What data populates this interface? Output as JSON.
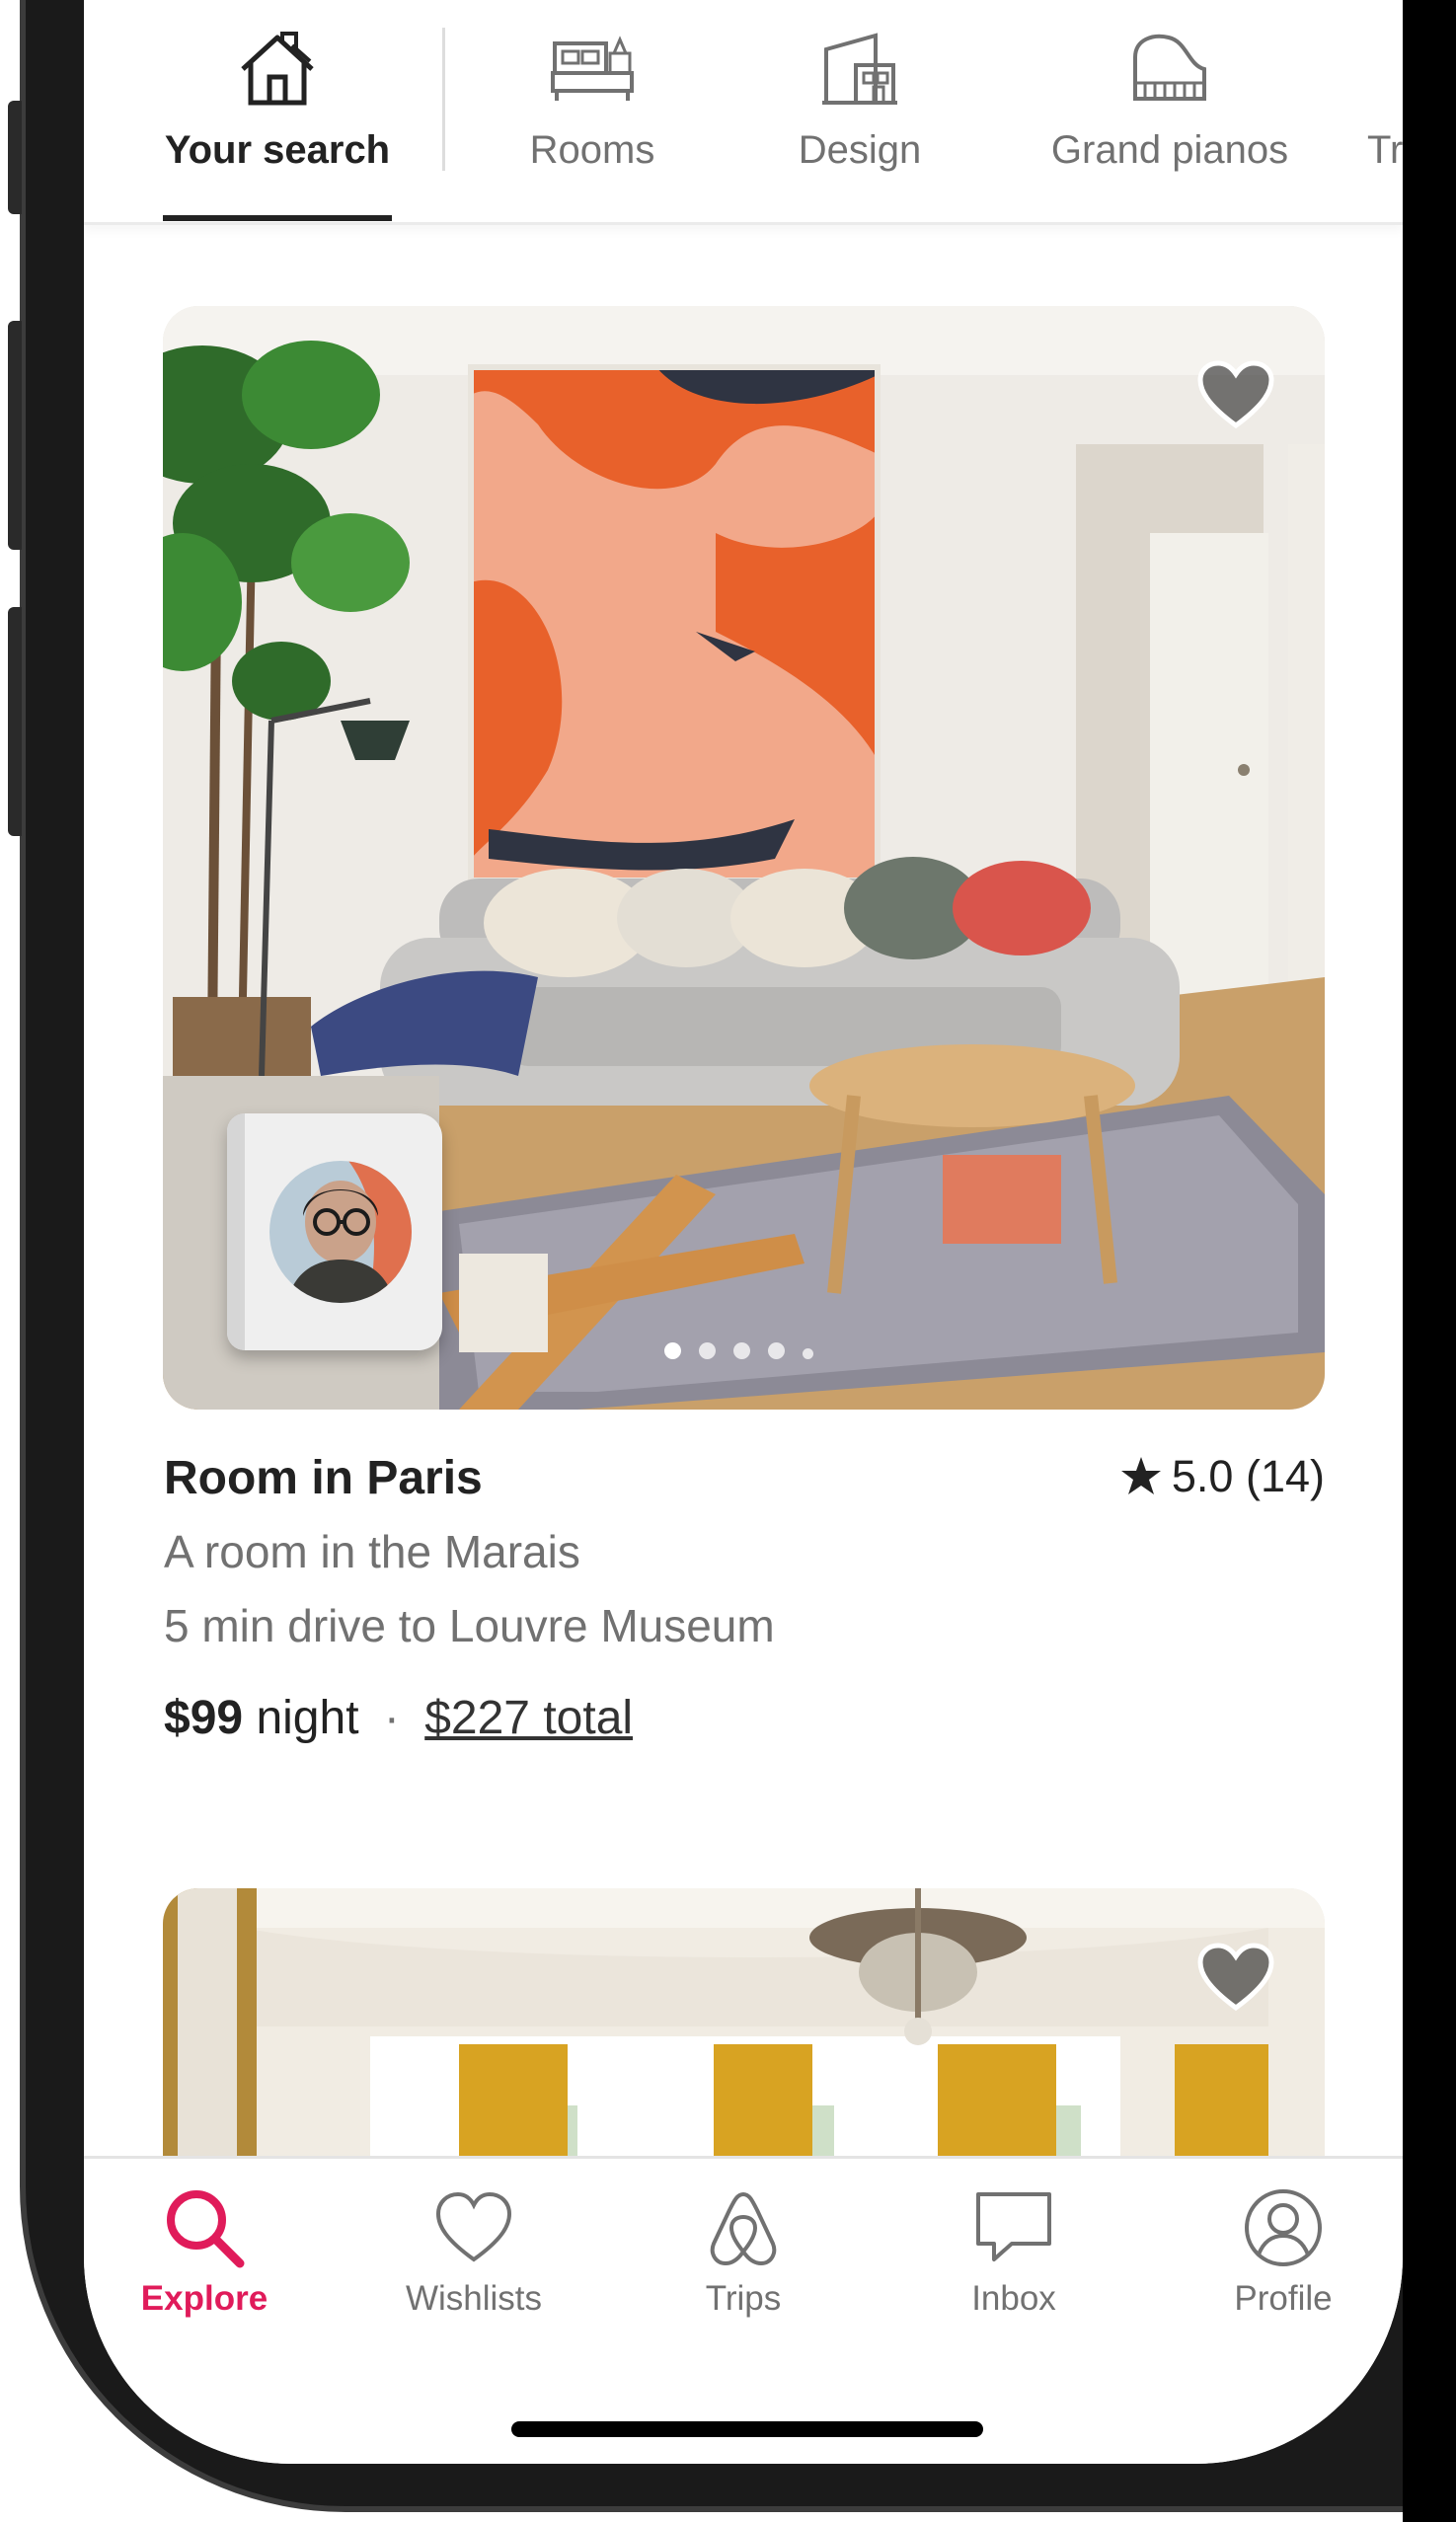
{
  "categories": [
    {
      "label": "Your search",
      "icon": "house-icon",
      "active": true
    },
    {
      "label": "Rooms",
      "icon": "bed-icon",
      "active": false
    },
    {
      "label": "Design",
      "icon": "building-icon",
      "active": false
    },
    {
      "label": "Grand pianos",
      "icon": "piano-icon",
      "active": false
    },
    {
      "label": "Tr",
      "icon": "",
      "active": false
    }
  ],
  "listing": {
    "title": "Room in Paris",
    "rating": "5.0 (14)",
    "subtitle_1": "A room in the Marais",
    "subtitle_2": "5 min drive to Louvre Museum",
    "price": "$99",
    "price_unit": "night",
    "separator": "·",
    "total": "$227 total",
    "photo_count": 5,
    "current_photo": 1
  },
  "tabs": [
    {
      "label": "Explore",
      "icon": "search-icon",
      "active": true
    },
    {
      "label": "Wishlists",
      "icon": "heart-icon",
      "active": false
    },
    {
      "label": "Trips",
      "icon": "airbnb-logo-icon",
      "active": false
    },
    {
      "label": "Inbox",
      "icon": "message-icon",
      "active": false
    },
    {
      "label": "Profile",
      "icon": "profile-icon",
      "active": false
    }
  ],
  "colors": {
    "accent": "#e01b5a",
    "text_primary": "#222222",
    "text_secondary": "#717171"
  }
}
